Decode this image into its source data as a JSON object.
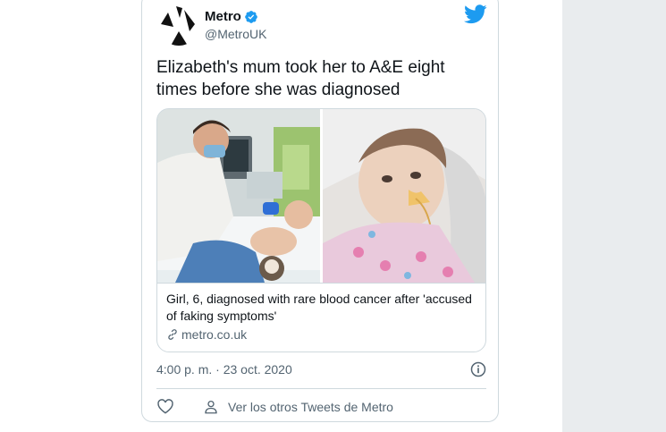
{
  "tweet": {
    "display_name": "Metro",
    "handle": "@MetroUK",
    "text": "Elizabeth's mum took her to A&E eight times before she was diagnosed",
    "timestamp": "4:00 p. m. · 23 oct. 2020",
    "profile_link_label": "Ver los otros Tweets de Metro"
  },
  "link_card": {
    "title": "Girl, 6, diagnosed with rare blood cancer after 'accused of faking symptoms'",
    "domain": "metro.co.uk"
  },
  "colors": {
    "twitter_blue": "#1d9bf0",
    "text_primary": "#0f1419",
    "text_secondary": "#536471",
    "border": "#cfd9de",
    "side_panel": "#e9ecee"
  },
  "icons": {
    "verified": "verified-badge-icon",
    "logo": "twitter-bird-icon",
    "link": "link-icon",
    "info": "info-icon",
    "like": "heart-icon",
    "profile": "person-icon"
  }
}
